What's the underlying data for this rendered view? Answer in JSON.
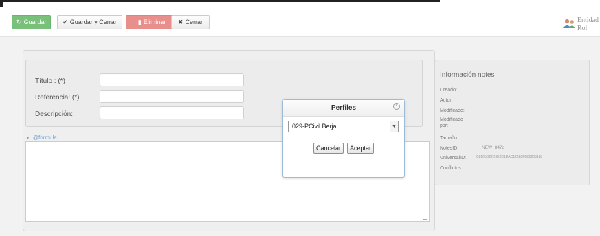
{
  "toolbar": {
    "guardar": "Guardar",
    "guardar_cerrar": "Guardar y Cerrar",
    "eliminar": "Eliminar",
    "cerrar": "Cerrar",
    "icons": {
      "guardar": "refresh-icon",
      "guardar_cerrar": "check-icon",
      "eliminar": "trash-icon",
      "cerrar": "close-icon"
    }
  },
  "header": {
    "entidad": "Entidad",
    "rol": "Rol"
  },
  "form": {
    "titulo_label": "Título : (*)",
    "referencia_label": "Referencia: (*)",
    "descripcion_label": "Descripción:",
    "titulo_value": "",
    "referencia_value": "",
    "descripcion_value": "",
    "formula_toggle": "@formula"
  },
  "info": {
    "title": "Información notes",
    "rows": [
      {
        "label": "Creado:",
        "value": ""
      },
      {
        "label": "Autor:",
        "value": ""
      },
      {
        "label": "Modificado:",
        "value": ""
      },
      {
        "label": "Modificado por:",
        "value": ""
      },
      {
        "label": "Tamaño:",
        "value": ""
      },
      {
        "label": "NotesID:",
        "value": "NEW_847d"
      },
      {
        "label": "UniversalID:",
        "value": "C8105D22D9E2D1DAC12583FD00263188"
      },
      {
        "label": "Conflictos:",
        "value": ""
      }
    ]
  },
  "modal": {
    "title": "Perfiles",
    "selected": "029-PCivil Berja",
    "cancel": "Cancelar",
    "accept": "Aceptar"
  },
  "colors": {
    "green": "#79c17a",
    "red": "#e88f8c",
    "link": "#6aa4d6"
  }
}
